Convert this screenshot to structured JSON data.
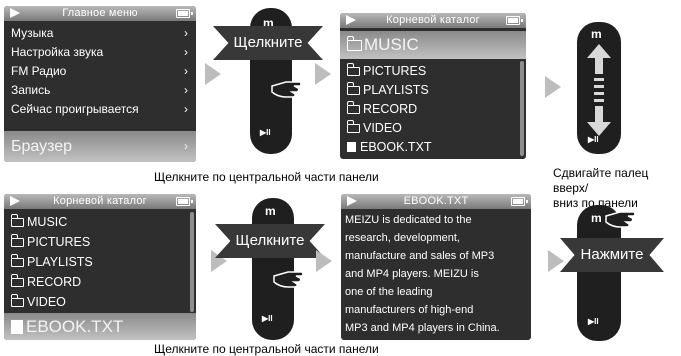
{
  "screen_main_menu": {
    "title": "Главное меню",
    "items": [
      "Музыка",
      "Настройка звука",
      "FM Радио",
      "Запись",
      "Сейчас проигрывается"
    ],
    "selected": "Браузер"
  },
  "screen_root_top": {
    "title": "Корневой каталог",
    "selected": "MUSIC",
    "items": [
      "PICTURES",
      "PLAYLISTS",
      "RECORD",
      "VIDEO",
      "EBOOK.TXT"
    ]
  },
  "screen_root_bottom": {
    "title": "Корневой каталог",
    "items": [
      "MUSIC",
      "PICTURES",
      "PLAYLISTS",
      "RECORD",
      "VIDEO"
    ],
    "selected": "EBOOK.TXT"
  },
  "screen_ebook": {
    "title": "EBOOK.TXT",
    "lines": [
      "MEIZU is dedicated to the",
      "research, development,",
      "manufacture and sales of MP3",
      "and MP4 players. MEIZU is",
      "one of the leading",
      "manufacturers of high-end",
      "MP3 and MP4 players in China."
    ]
  },
  "device": {
    "menu_key": "m",
    "play_key": "▶II"
  },
  "labels": {
    "click": "Щелкните",
    "press": "Нажмите",
    "swipe_caption": "Сдвигайте палец вверх/\nвниз по панели",
    "caption_top": "Щелкните по центральной части панели",
    "caption_bottom": "Щелкните по центральной части панели"
  },
  "colors": {
    "screen_bg": "#2e2e2e",
    "device": "#1f1f1f",
    "arrow": "#bdbdbd"
  }
}
